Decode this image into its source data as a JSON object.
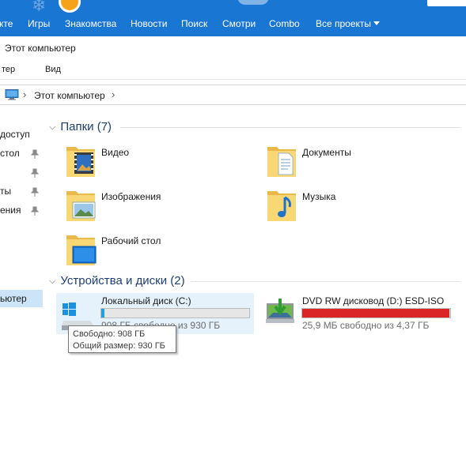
{
  "topnav": {
    "items": [
      "кте",
      "Игры",
      "Знакомства",
      "Новости",
      "Поиск",
      "Смотри",
      "Combo",
      "Все проекты"
    ]
  },
  "window": {
    "title": "Этот компьютер",
    "ribbon": [
      "тер",
      "Вид"
    ]
  },
  "address": {
    "crumb": "Этот компьютер"
  },
  "sidebar": {
    "items": [
      "доступ",
      "стол",
      "ты",
      "ения",
      "ьютер"
    ]
  },
  "folders_group": {
    "header": "Папки (7)",
    "items": [
      {
        "label": "Видео",
        "overlay": "film-icon"
      },
      {
        "label": "Документы",
        "overlay": "document-icon"
      },
      {
        "label": "Изображения",
        "overlay": "picture-icon"
      },
      {
        "label": "Музыка",
        "overlay": "music-note-icon"
      },
      {
        "label": "Рабочий стол",
        "overlay": "desktop-icon"
      }
    ]
  },
  "devices_group": {
    "header": "Устройства и диски (2)",
    "drives": [
      {
        "label": "Локальный диск (C:)",
        "free_text": "908 ГБ свободно из 930 ГБ",
        "used_fraction": 0.024,
        "bar_color": "#26a0da"
      },
      {
        "label": "DVD RW дисковод (D:) ESD-ISO",
        "free_text": "25,9 МБ свободно из 4,37 ГБ",
        "used_fraction": 0.994,
        "bar_color": "#da2626"
      }
    ]
  },
  "tooltip": {
    "line1": "Свободно: 908 ГБ",
    "line2": "Общий размер: 930 ГБ"
  },
  "colors": {
    "top_bar": "#1976d2",
    "folder_yellow": "#f8d775",
    "header_blue": "#1e3f6e",
    "hover_bg": "#e5f1fb"
  }
}
